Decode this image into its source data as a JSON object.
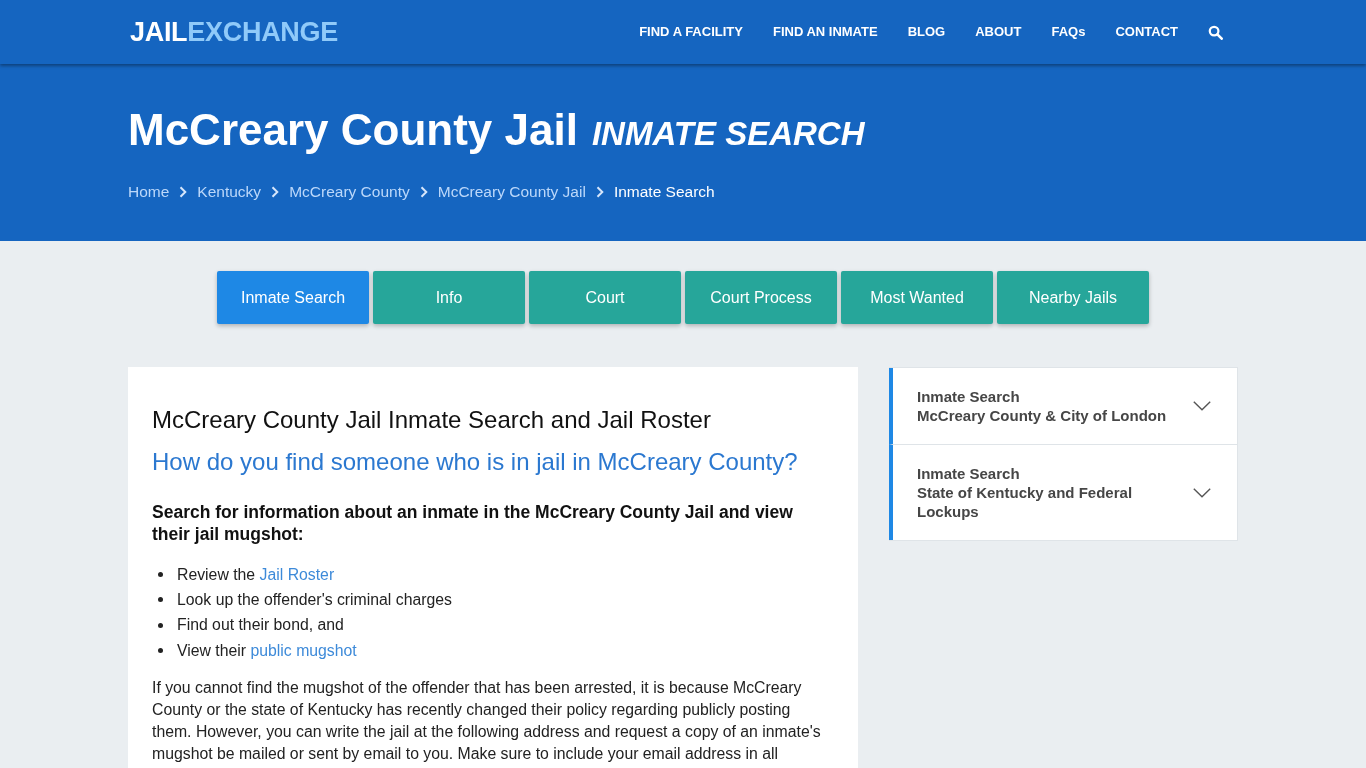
{
  "header": {
    "logo": {
      "primary": "JAIL",
      "accent": "EXCHANGE"
    },
    "nav": [
      "FIND A FACILITY",
      "FIND AN INMATE",
      "BLOG",
      "ABOUT",
      "FAQs",
      "CONTACT"
    ]
  },
  "hero": {
    "title": "McCreary County Jail",
    "title_suffix": "INMATE SEARCH",
    "breadcrumbs": [
      {
        "label": "Home",
        "current": false
      },
      {
        "label": "Kentucky",
        "current": false
      },
      {
        "label": "McCreary County",
        "current": false
      },
      {
        "label": "McCreary County Jail",
        "current": false
      },
      {
        "label": "Inmate Search",
        "current": true
      }
    ]
  },
  "tabs": [
    {
      "label": "Inmate Search",
      "selected": true
    },
    {
      "label": "Info",
      "selected": false
    },
    {
      "label": "Court",
      "selected": false
    },
    {
      "label": "Court Process",
      "selected": false
    },
    {
      "label": "Most Wanted",
      "selected": false
    },
    {
      "label": "Nearby Jails",
      "selected": false
    }
  ],
  "article": {
    "heading": "McCreary County Jail Inmate Search and Jail Roster",
    "question": "How do you find someone who is in jail in McCreary County?",
    "subheading": "Search for information about an inmate in the McCreary County Jail and view their jail mugshot:",
    "list": [
      {
        "text": "Review the",
        "link": "Jail Roster"
      },
      {
        "text": "Look up the offender's criminal charges"
      },
      {
        "text": "Find out their bond, and"
      },
      {
        "text": "View their",
        "link": "public mugshot"
      }
    ],
    "paragraph": "If you cannot find the mugshot of the offender that has been arrested, it is because McCreary County or the state of Kentucky has recently changed their policy regarding publicly posting them. However, you can write the jail at the following address and request a copy of an inmate's mugshot be mailed or sent by email to you. Make sure to include your email address in all"
  },
  "sidebar": [
    {
      "title": "Inmate Search",
      "subtitle": "McCreary County & City of London",
      "expanded": false
    },
    {
      "title": "Inmate Search",
      "subtitle": "State of Kentucky and Federal Lockups",
      "expanded": false
    }
  ]
}
